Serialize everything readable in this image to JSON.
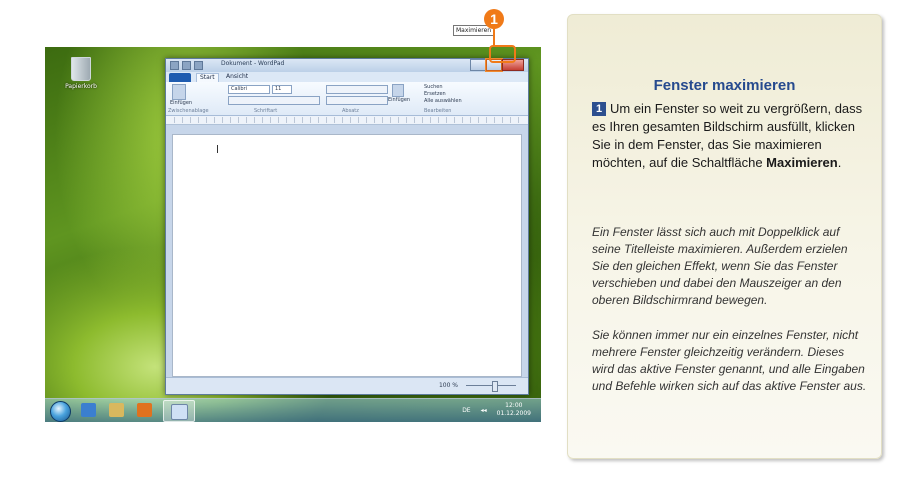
{
  "desktop": {
    "recycle_bin_label": "Papierkorb"
  },
  "window": {
    "title": "Dokument - WordPad",
    "tabs": [
      "Start",
      "Ansicht"
    ],
    "font_name": "Calibri",
    "font_size": "11",
    "groups": [
      "Zwischenablage",
      "Schriftart",
      "Absatz",
      "Bearbeiten"
    ],
    "paste_label": "Einfügen",
    "insert_label": "Einfügen",
    "edit_items": [
      "Suchen",
      "Ersetzen",
      "Alle auswählen"
    ],
    "zoom": "100 %"
  },
  "tooltip": "Maximieren",
  "marker_number": "1",
  "taskbar": {
    "lang": "DE",
    "time": "12:00",
    "date": "01.12.2009"
  },
  "card": {
    "title": "Fenster maximieren",
    "step_number": "1",
    "p1_text": "Um ein Fenster so weit zu vergrößern, dass es Ihren gesamten Bildschirm ausfüllt, klicken Sie in dem Fenster, das Sie maximieren möchten, auf die Schaltfläche ",
    "p1_bold": "Maximieren",
    "p1_end": ".",
    "p2": "Ein Fenster lässt sich auch mit Doppelklick auf seine Titelleiste maximieren. Außerdem erzielen Sie den gleichen Effekt, wenn Sie das Fenster verschieben und dabei den Mauszeiger an den oberen Bildschirmrand bewegen.",
    "p3": "Sie können immer nur ein einzelnes Fenster, nicht mehrere Fenster gleichzeitig verändern. Dieses wird das aktive Fenster genannt, und alle Eingaben und Befehle wirken sich auf das aktive Fenster aus."
  },
  "colors": {
    "accent": "#f07a18",
    "title_blue": "#264a8e"
  }
}
